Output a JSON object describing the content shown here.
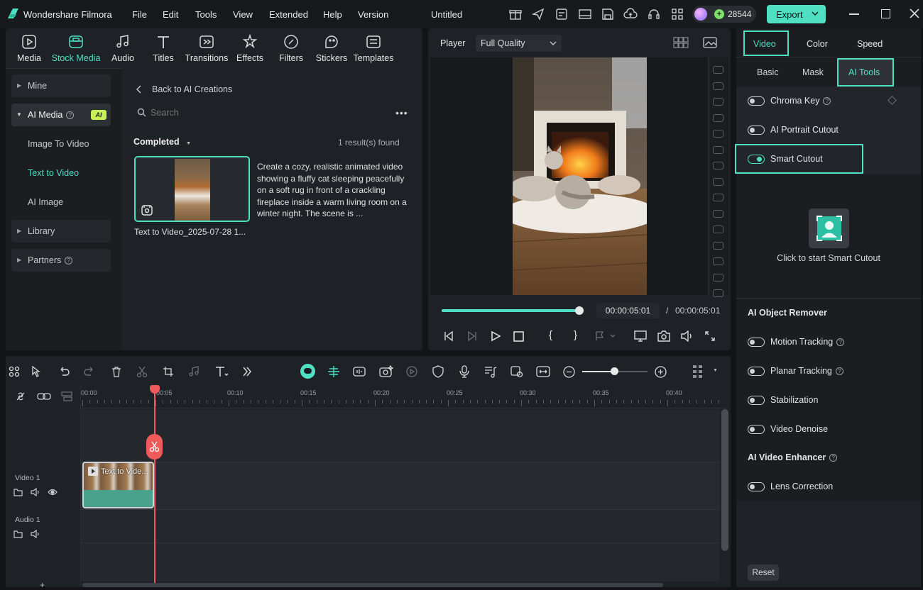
{
  "app": {
    "name": "Wondershare Filmora",
    "project_title": "Untitled",
    "credits": "28544",
    "export_label": "Export"
  },
  "menu": [
    "File",
    "Edit",
    "Tools",
    "View",
    "Extended",
    "Help",
    "Version"
  ],
  "media_toolbar": [
    "Media",
    "Stock Media",
    "Audio",
    "Titles",
    "Transitions",
    "Effects",
    "Filters",
    "Stickers",
    "Templates"
  ],
  "sidebar": {
    "mine": "Mine",
    "ai_media": "AI Media",
    "ai_badge": "AI",
    "image_to_video": "Image To Video",
    "text_to_video": "Text to Video",
    "ai_image": "AI Image",
    "library": "Library",
    "partners": "Partners"
  },
  "browser": {
    "back_label": "Back to AI Creations",
    "search_placeholder": "Search",
    "filter_label": "Completed",
    "results": "1 result(s) found",
    "item_description": "Create a cozy, realistic animated video showing a fluffy cat sleeping peacefully on a soft rug in front of a crackling fireplace inside a warm living room on a winter night. The scene is ...",
    "item_title": "Text to Video_2025-07-28 1..."
  },
  "player": {
    "label": "Player",
    "quality": "Full Quality",
    "current_time": "00:00:05:01",
    "separator": "/",
    "total_time": "00:00:05:01",
    "progress": 1.0
  },
  "properties": {
    "tabs": [
      "Video",
      "Color",
      "Speed"
    ],
    "subtabs": [
      "Basic",
      "Mask",
      "AI Tools"
    ],
    "chroma_key": "Chroma Key",
    "ai_portrait": "AI Portrait Cutout",
    "smart_cutout": "Smart Cutout",
    "smart_cutout_hint": "Click to start Smart Cutout",
    "object_remover": "AI Object Remover",
    "motion_tracking": "Motion Tracking",
    "planar_tracking": "Planar Tracking",
    "stabilization": "Stabilization",
    "video_denoise": "Video Denoise",
    "video_enhancer": "AI Video Enhancer",
    "lens_correction": "Lens Correction",
    "reset": "Reset"
  },
  "timeline": {
    "ruler": [
      "00:00",
      "00:05",
      "00:10",
      "00:15",
      "00:20",
      "00:25",
      "00:30",
      "00:35",
      "00:40"
    ],
    "video_track": "Video 1",
    "audio_track": "Audio 1",
    "clip_label": "Text to Vide..."
  },
  "colors": {
    "accent": "#4fe0c4",
    "playhead": "#ef5a5a"
  }
}
